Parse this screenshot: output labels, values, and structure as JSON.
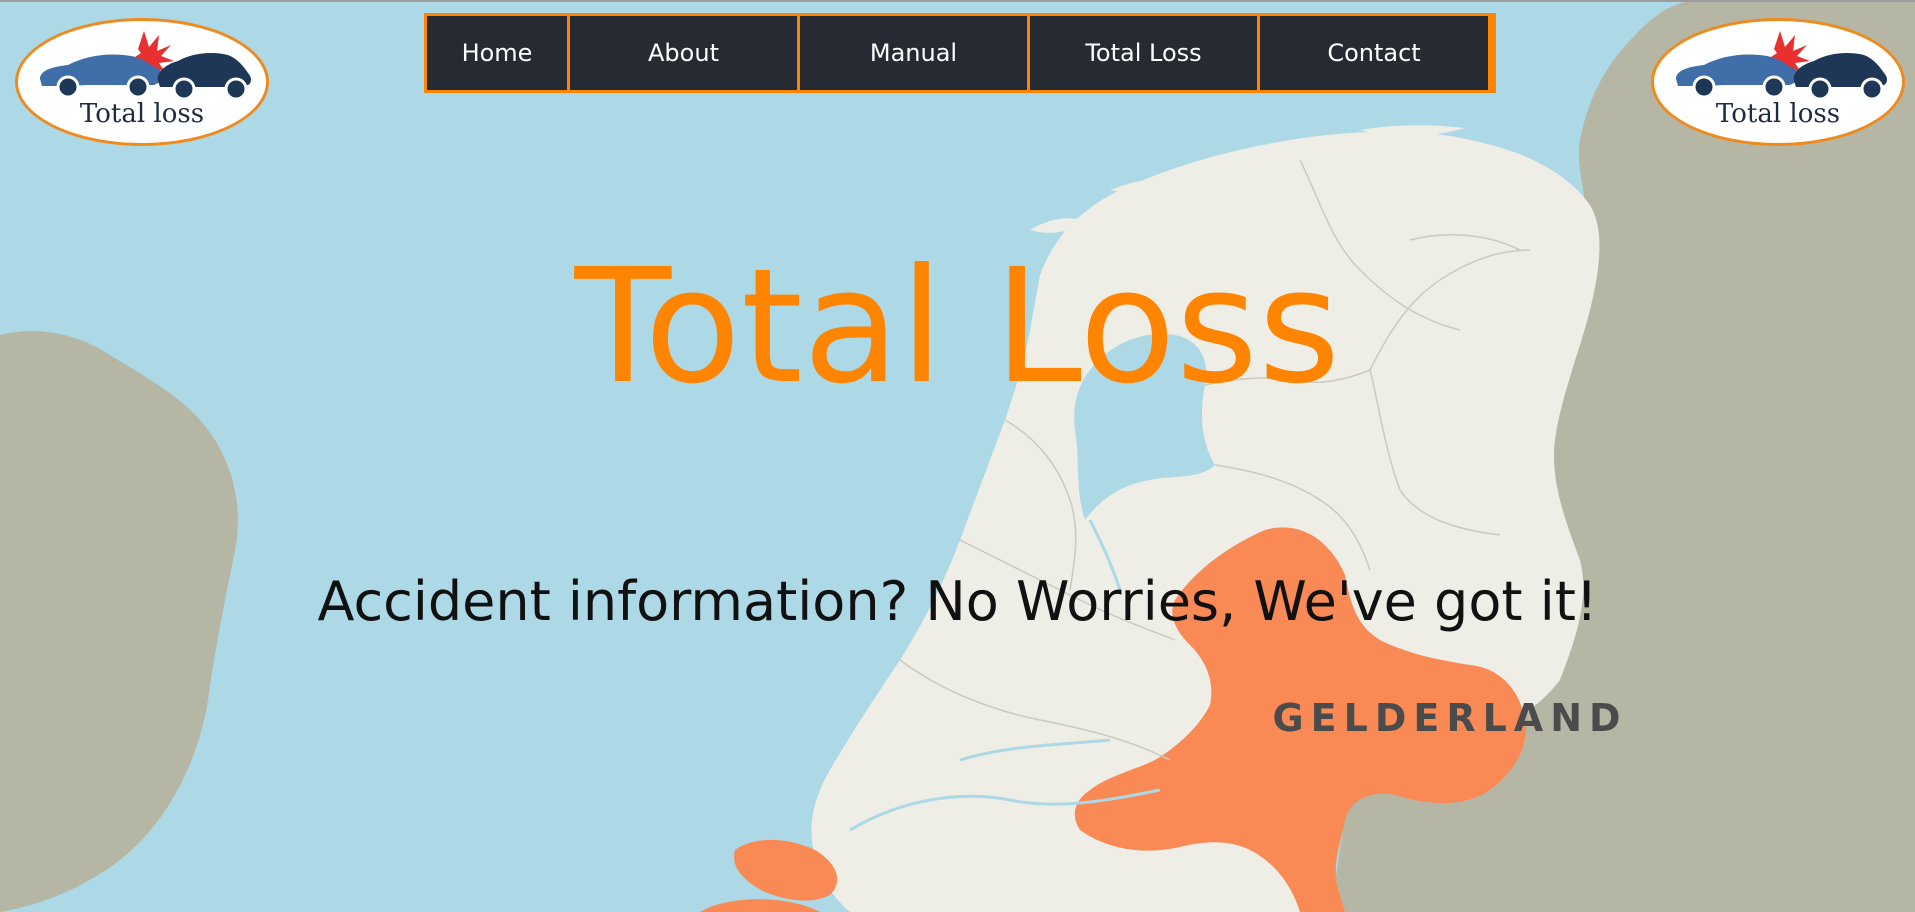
{
  "brand": {
    "logo_text": "Total loss"
  },
  "nav": {
    "items": [
      {
        "label": "Home"
      },
      {
        "label": "About"
      },
      {
        "label": "Manual"
      },
      {
        "label": "Total Loss"
      },
      {
        "label": "Contact"
      }
    ]
  },
  "hero": {
    "title": "Total Loss",
    "subtitle": "Accident information? No Worries, We've got it!"
  },
  "map": {
    "highlighted_region_label": "GELDERLAND"
  },
  "colors": {
    "accent": "#ff8400",
    "nav_background": "#262b33",
    "water": "#add8e6",
    "land": "#eeeee7",
    "neighbor_land": "#b5b6a4",
    "highlight_region": "#f98a55"
  }
}
